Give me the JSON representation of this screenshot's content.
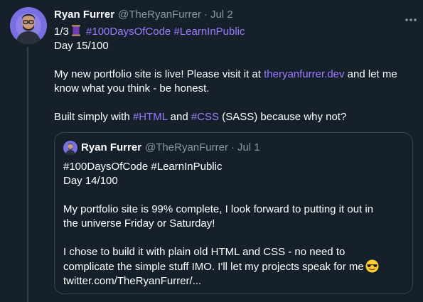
{
  "tweet": {
    "author_name": "Ryan Furrer",
    "author_handle": "@TheRyanFurrer",
    "separator": "·",
    "date": "Jul 2",
    "more_icon": "more-horizontal-icon",
    "avatar_icon": "user-avatar",
    "line1_prefix": "1/3",
    "line1_emoji": "spool-of-thread-icon",
    "line1_tag1": "#100DaysOfCode",
    "line1_tag2": "#LearnInPublic",
    "line2": "Day 15/100",
    "p2_text1": "My new portfolio site is live! Please visit it at ",
    "p2_link": "theryanfurrer.dev",
    "p2_text2": " and let me",
    "p2_line2": "know what you think - be honest.",
    "p3_text1": "Built simply with ",
    "p3_tag1": "#HTML",
    "p3_text2": " and ",
    "p3_tag2": "#CSS",
    "p3_text3": " (SASS) because why not?"
  },
  "quote": {
    "author_name": "Ryan Furrer",
    "author_handle": "@TheRyanFurrer",
    "separator": "·",
    "date": "Jul 1",
    "line1": "#100DaysOfCode #LearnInPublic",
    "line2": "Day 14/100",
    "p2_line1": "My portfolio site is 99% complete, I look forward to putting it out in",
    "p2_line2": "the universe Friday or Saturday!",
    "p3_line1": "I chose to build it with plain old HTML and CSS - no need to",
    "p3_line2": "complicate the simple stuff IMO. I'll let my projects speak for me",
    "p3_emoji": "sunglasses-face-icon",
    "p3_line3": "twitter.com/TheRyanFurrer/..."
  },
  "colors": {
    "background": "#15202b",
    "text": "#ffffff",
    "muted": "#8899a6",
    "link": "#9d7bff",
    "border": "#38444d"
  }
}
